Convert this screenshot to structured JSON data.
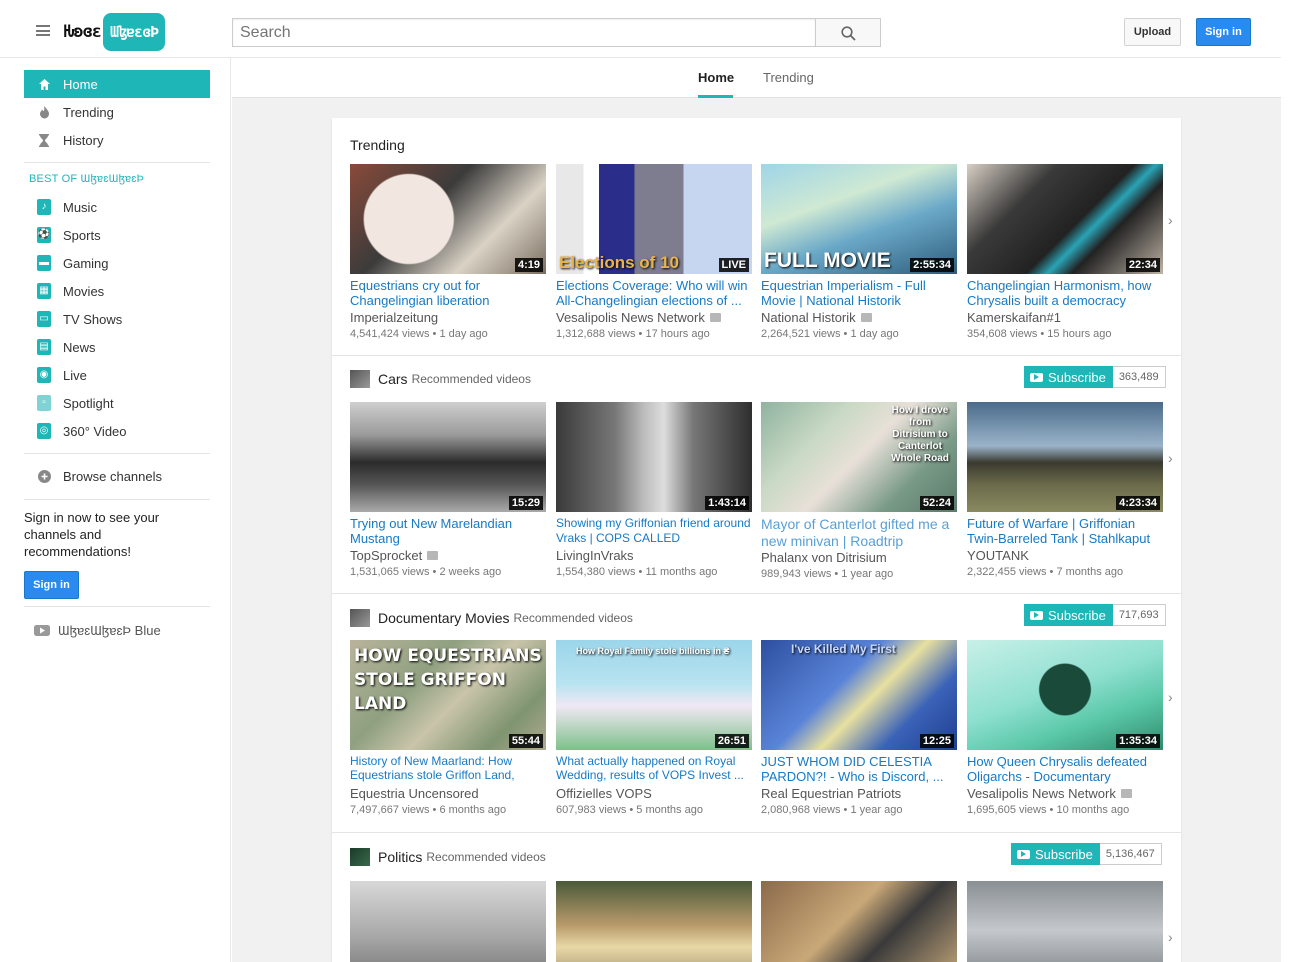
{
  "header": {
    "logo_left": "Ƕʚɞɛ",
    "logo_right": "ƜɮɐɛɞÞ",
    "search_placeholder": "Search",
    "upload_label": "Upload",
    "signin_label": "Sign in"
  },
  "sidebar": {
    "main_items": [
      {
        "label": "Home",
        "icon": "home-icon"
      },
      {
        "label": "Trending",
        "icon": "flame-icon"
      },
      {
        "label": "History",
        "icon": "hourglass-icon"
      }
    ],
    "best_of_label": "BEST OF ƜɮɐɛƜɮɐɛÞ",
    "best_items": [
      {
        "label": "Music"
      },
      {
        "label": "Sports"
      },
      {
        "label": "Gaming"
      },
      {
        "label": "Movies"
      },
      {
        "label": "TV Shows"
      },
      {
        "label": "News"
      },
      {
        "label": "Live"
      },
      {
        "label": "Spotlight"
      },
      {
        "label": "360° Video"
      }
    ],
    "browse_label": "Browse channels",
    "signin_message": "Sign in now to see your channels and recommendations!",
    "signin_label": "Sign in",
    "blue_label": "ƜɮɐɛƜɮɐɛÞ Blue"
  },
  "tabs": [
    {
      "label": "Home",
      "active": true
    },
    {
      "label": "Trending",
      "active": false
    }
  ],
  "sections": [
    {
      "title": "Trending",
      "videos": [
        {
          "title": "Equestrians cry out for Changelingian liberation",
          "channel": "Imperialzeitung",
          "verified": false,
          "views": "4,541,424 views",
          "age": "1 day ago",
          "duration": "4:19"
        },
        {
          "title": "Elections Coverage: Who will win All-Changelingian elections of ...",
          "channel": "Vesalipolis News Network",
          "verified": true,
          "views": "1,312,688 views",
          "age": "17 hours ago",
          "duration": "LIVE",
          "overlay": "Elections of 10"
        },
        {
          "title": "Equestrian Imperialism - Full Movie | National Historik",
          "channel": "National Historik",
          "verified": true,
          "views": "2,264,521 views",
          "age": "1 day ago",
          "duration": "2:55:34",
          "overlay": "FULL MOVIE"
        },
        {
          "title": "Changelingian Harmonism, how Chrysalis built a democracy",
          "channel": "Kamerskaifan#1",
          "verified": false,
          "views": "354,608 views",
          "age": "15 hours ago",
          "duration": "22:34"
        }
      ]
    },
    {
      "title": "Cars",
      "recommended": "Recommended videos",
      "subscribe": "Subscribe",
      "subscribers": "363,489",
      "videos": [
        {
          "title": "Trying out New Marelandian Mustang",
          "channel": "TopSprocket",
          "verified": true,
          "views": "1,531,065 views",
          "age": "2 weeks ago",
          "duration": "15:29"
        },
        {
          "title": "Showing my Griffonian friend around Vraks | COPS CALLED",
          "channel": "LivingInVraks",
          "verified": false,
          "views": "1,554,380 views",
          "age": "11 months ago",
          "duration": "1:43:14"
        },
        {
          "title": "Mayor of Canterlot gifted me a new minivan | Roadtrip",
          "channel": "Phalanx von Ditrisium",
          "verified": false,
          "views": "989,943 views",
          "age": "1 year ago",
          "duration": "52:24",
          "overlay": "How I drove from Ditrisium to Canterlot Whole Road"
        },
        {
          "title": "Future of Warfare | Griffonian Twin-Barreled Tank | Stahlkaput",
          "channel": "YOUTANK",
          "verified": false,
          "views": "2,322,455 views",
          "age": "7 months ago",
          "duration": "4:23:34"
        }
      ]
    },
    {
      "title": "Documentary Movies",
      "recommended": "Recommended videos",
      "subscribe": "Subscribe",
      "subscribers": "717,693",
      "videos": [
        {
          "title": "History of New Maarland: How Equestrians stole Griffon Land, how...",
          "channel": "Equestria Uncensored",
          "verified": false,
          "views": "7,497,667 views",
          "age": "6 months ago",
          "duration": "55:44",
          "overlay": "HOW EQUESTRIANS STOLE GRIFFON LAND"
        },
        {
          "title": "What actually happened on Royal Wedding, results of VOPS Invest ...",
          "channel": "Offizielles VOPS",
          "verified": false,
          "views": "607,983 views",
          "age": "5 months ago",
          "duration": "26:51",
          "overlay": "How Royal Family stole billions in ₴"
        },
        {
          "title": "JUST WHOM DID CELESTIA PARDON?! - Who is Discord, ...",
          "channel": "Real Equestrian Patriots",
          "verified": false,
          "views": "2,080,968 views",
          "age": "1 year ago",
          "duration": "12:25",
          "overlay": "I've Killed My First"
        },
        {
          "title": "How Queen Chrysalis defeated Oligarchs - Documentary",
          "channel": "Vesalipolis News Network",
          "verified": true,
          "views": "1,695,605 views",
          "age": "10 months ago",
          "duration": "1:35:34"
        }
      ]
    },
    {
      "title": "Politics",
      "recommended": "Recommended videos",
      "subscribe": "Subscribe",
      "subscribers": "5,136,467",
      "videos": []
    }
  ],
  "colors": {
    "accent": "#1fb6b8",
    "link": "#167ac6",
    "signin": "#2a8af0"
  }
}
